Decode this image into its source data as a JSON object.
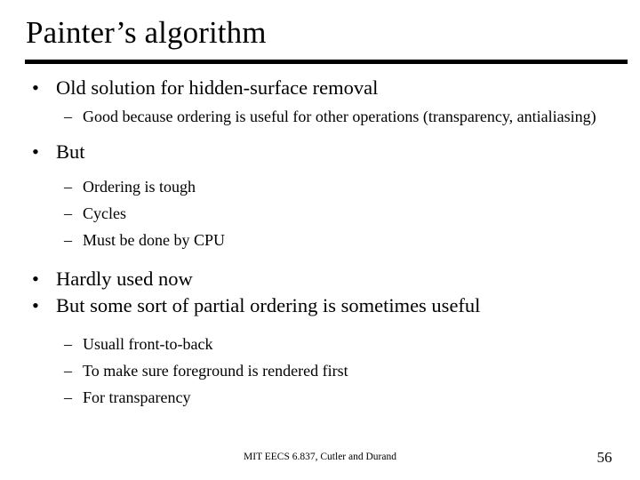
{
  "slide": {
    "title": "Painter’s algorithm",
    "page_number": "56",
    "footer": "MIT EECS 6.837, Cutler and Durand",
    "text_color": "#000000",
    "background_color": "#ffffff",
    "rule_color": "#000000"
  },
  "bullets": {
    "level1_marker": "•",
    "level2_marker": "–",
    "items": [
      {
        "level": 1,
        "text": "Old solution for hidden-surface removal"
      },
      {
        "level": 2,
        "text": "Good because ordering is useful for other operations (transparency, antialiasing)"
      },
      {
        "level": 1,
        "text": "But"
      },
      {
        "level": 2,
        "text": "Ordering is tough"
      },
      {
        "level": 2,
        "text": "Cycles"
      },
      {
        "level": 2,
        "text": "Must be done by CPU"
      },
      {
        "level": 1,
        "text": "Hardly used now"
      },
      {
        "level": 1,
        "text": "But some sort of partial ordering is sometimes useful"
      },
      {
        "level": 2,
        "text": "Usuall front-to-back"
      },
      {
        "level": 2,
        "text": "To make sure foreground is rendered first"
      },
      {
        "level": 2,
        "text": "For transparency"
      }
    ]
  }
}
